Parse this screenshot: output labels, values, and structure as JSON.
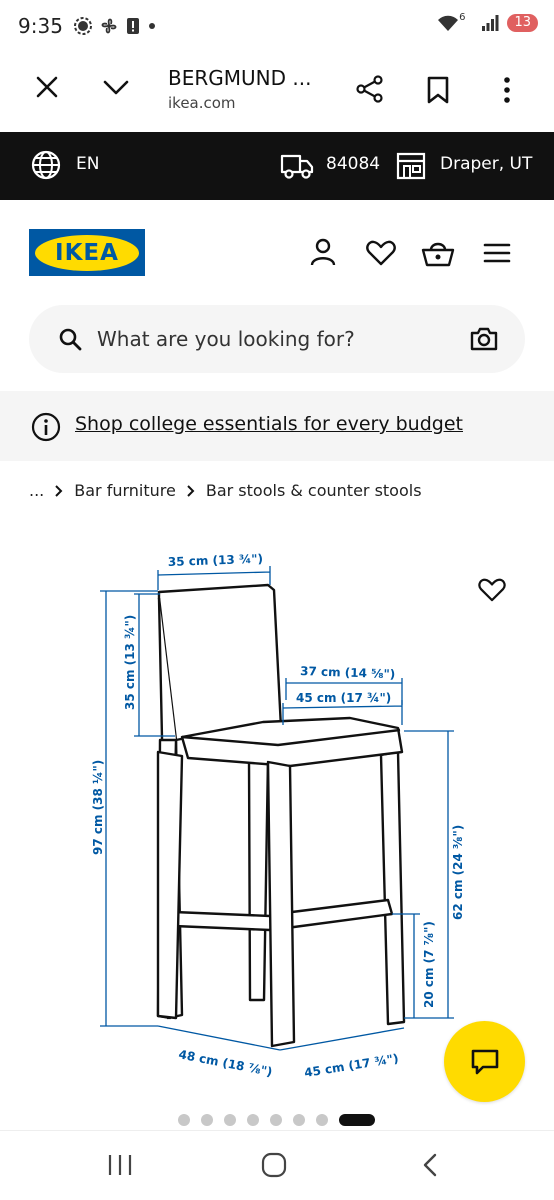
{
  "status": {
    "time": "9:35",
    "network": "6",
    "battery": "13"
  },
  "browser": {
    "title": "BERGMUND ...",
    "domain": "ikea.com"
  },
  "topbar": {
    "language": "EN",
    "zip": "84084",
    "store": "Draper, UT"
  },
  "logo": {
    "text": "IKEA"
  },
  "search": {
    "placeholder": "What are you looking for?"
  },
  "promo": {
    "text": "Shop college essentials for every budget"
  },
  "breadcrumb": {
    "ellipsis": "...",
    "items": [
      "Bar furniture",
      "Bar stools & counter stools"
    ]
  },
  "dimensions": {
    "back_width": "35 cm (13 ¾\")",
    "back_height": "35 cm (13 ¾\")",
    "total_height": "97 cm (38 ¼\")",
    "seat_depth": "37 cm (14 ⅝\")",
    "seat_width": "45 cm (17 ¾\")",
    "seat_height": "62 cm (24 ⅜\")",
    "footrest_height": "20 cm (7 ⅞\")",
    "base_width": "48 cm (18 ⅞\")",
    "base_depth": "45 cm (17 ¾\")"
  },
  "carousel": {
    "count": 8,
    "active_index": 7
  },
  "icons": [
    "close-icon",
    "chevron-down-icon",
    "share-icon",
    "bookmark-icon",
    "more-vert-icon",
    "globe-icon",
    "truck-icon",
    "store-icon",
    "user-icon",
    "heart-icon",
    "basket-icon",
    "menu-icon",
    "search-icon",
    "camera-icon",
    "info-icon",
    "chat-icon"
  ],
  "colors": {
    "ikea_blue": "#0058a3",
    "ikea_yellow": "#ffdb00",
    "topbar": "#111111"
  }
}
